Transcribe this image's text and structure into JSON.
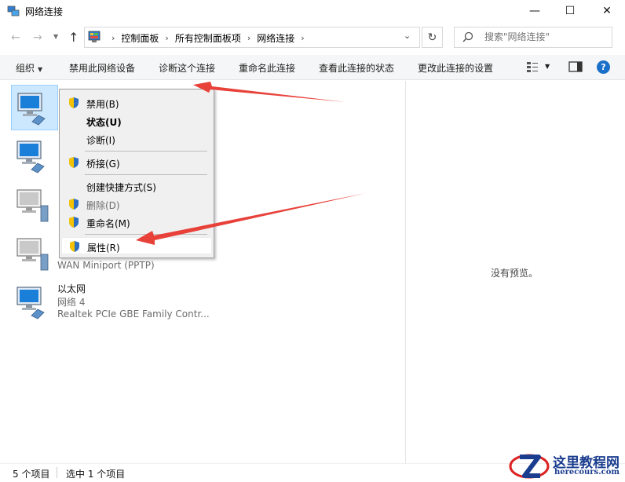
{
  "window": {
    "title": "网络连接",
    "minimize": "—",
    "maximize": "☐",
    "close": "✕"
  },
  "address": {
    "crumbs": [
      "控制面板",
      "所有控制面板项",
      "网络连接"
    ],
    "search_placeholder": "搜索\"网络连接\""
  },
  "toolbar": {
    "organize": "组织",
    "disable": "禁用此网络设备",
    "diagnose": "诊断这个连接",
    "rename": "重命名此连接",
    "status": "查看此连接的状态",
    "settings": "更改此连接的设置",
    "help": "?"
  },
  "connections": [
    {
      "name": "",
      "status": "",
      "device": ""
    },
    {
      "name": "",
      "status": "",
      "device": ""
    },
    {
      "name": "",
      "status": "",
      "device": ""
    },
    {
      "name": "",
      "status": "",
      "device": "WAN Miniport (PPTP)"
    },
    {
      "name": "以太网",
      "status": "网络 4",
      "device": "Realtek PCIe GBE Family Contr..."
    }
  ],
  "context_menu": {
    "disable": "禁用(B)",
    "status": "状态(U)",
    "diagnose": "诊断(I)",
    "bridge": "桥接(G)",
    "shortcut": "创建快捷方式(S)",
    "delete": "删除(D)",
    "rename": "重命名(M)",
    "properties": "属性(R)"
  },
  "preview": {
    "empty": "没有预览。"
  },
  "statusbar": {
    "count": "5 个项目",
    "selected": "选中 1 个项目"
  },
  "watermark": {
    "text": "这里教程网",
    "sub": "herecours.com"
  },
  "colors": {
    "accent": "#1a6fc9",
    "selection": "#cce8ff",
    "arrow": "#e8413a",
    "watermark": "#1b3d8f"
  }
}
